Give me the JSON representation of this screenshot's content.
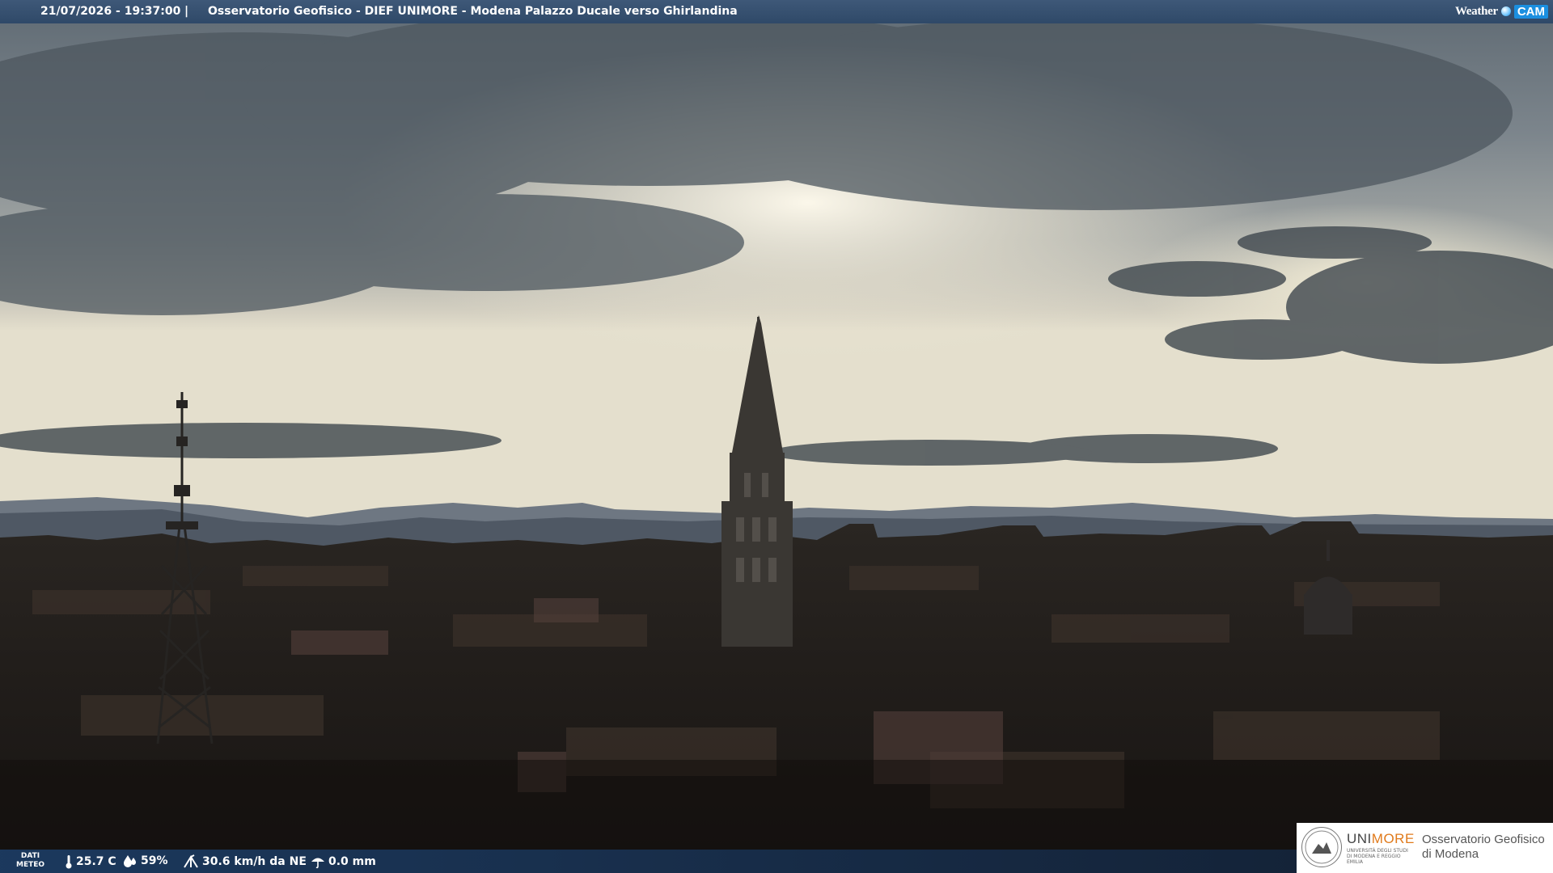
{
  "header": {
    "datetime": "21/07/2026 - 19:37:00",
    "separator": "|",
    "title": "Osservatorio Geofisico - DIEF UNIMORE - Modena Palazzo Ducale verso Ghirlandina",
    "brand_weather": "Weather",
    "brand_cam": "CAM"
  },
  "meteo": {
    "label_line1": "DATI",
    "label_line2": "METEO",
    "temperature": "25.7 C",
    "humidity": "59%",
    "wind": "30.6 km/h da NE",
    "rain": "0.0 mm",
    "icons": [
      "thermometer-icon",
      "humidity-drop-icon",
      "wind-icon",
      "rain-umbrella-icon"
    ]
  },
  "logo": {
    "uni_prefix": "UNI",
    "uni_suffix": "MORE",
    "uni_sub": "UNIVERSITÀ DEGLI STUDI DI MODENA E REGGIO EMILIA",
    "obs_line1": "Osservatorio Geofisico",
    "obs_line2": "di Modena"
  },
  "colors": {
    "bar": "#2f4968",
    "unimore_orange": "#e07a1b",
    "brand_blue": "#1b8fe0"
  }
}
